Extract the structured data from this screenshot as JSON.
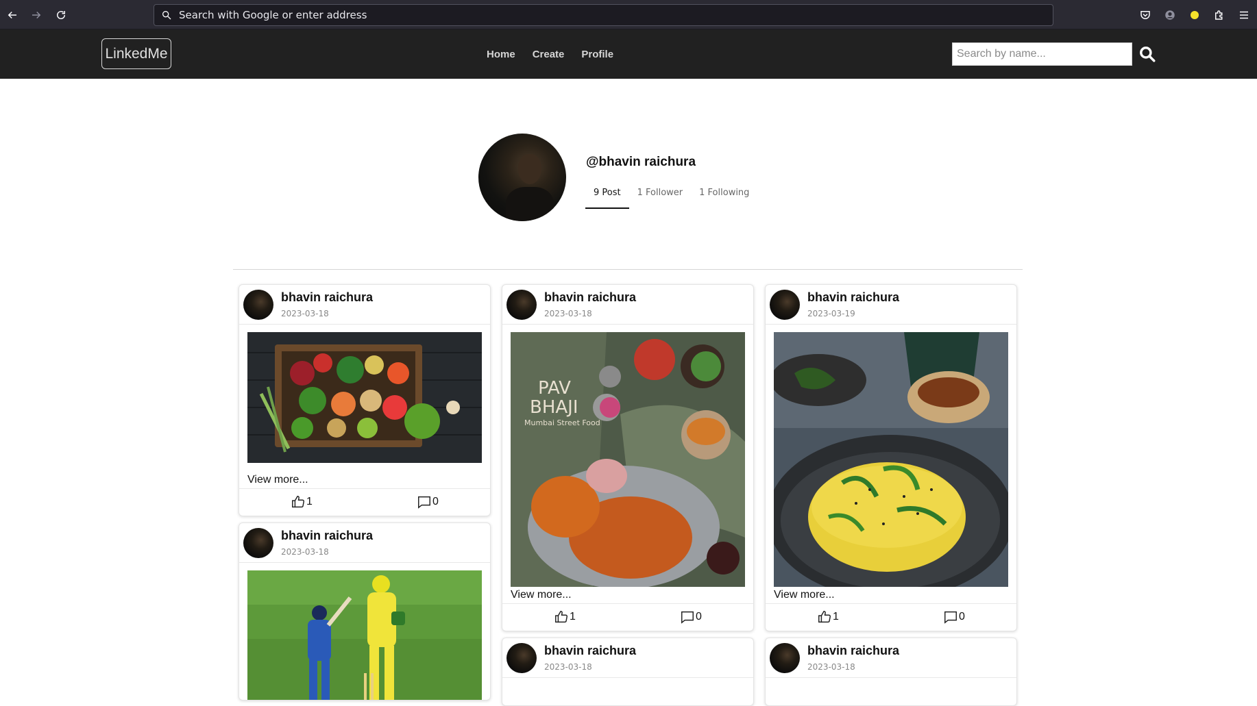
{
  "browser": {
    "address_placeholder": "Search with Google or enter address"
  },
  "navbar": {
    "brand": "LinkedMe",
    "links": [
      "Home",
      "Create",
      "Profile"
    ],
    "search_placeholder": "Search by name..."
  },
  "profile": {
    "username": "@bhavin raichura",
    "stats": [
      "9 Post",
      "1 Follower",
      "1 Following"
    ],
    "active_stat": "9 Post"
  },
  "posts": [
    {
      "author": "bhavin raichura",
      "date": "2023-03-18",
      "image": "vegetable-crate-photo",
      "view_more": "View more...",
      "likes": "1",
      "comments": "0"
    },
    {
      "author": "bhavin raichura",
      "date": "2023-03-18",
      "image": "pav-bhaji-photo",
      "image_text": [
        "PAV",
        "BHAJI",
        "Mumbai Street Food"
      ],
      "view_more": "View more...",
      "likes": "1",
      "comments": "0"
    },
    {
      "author": "bhavin raichura",
      "date": "2023-03-19",
      "image": "dhokla-photo",
      "view_more": "View more...",
      "likes": "1",
      "comments": "0"
    },
    {
      "author": "bhavin raichura",
      "date": "2023-03-18",
      "image": "cricket-photo"
    },
    {
      "author": "bhavin raichura",
      "date": "2023-03-18"
    },
    {
      "author": "bhavin raichura",
      "date": "2023-03-18"
    }
  ],
  "colors": {
    "navbar_bg": "#212121",
    "chrome_bg": "#2b2a33",
    "page_bg": "#ffffff"
  }
}
